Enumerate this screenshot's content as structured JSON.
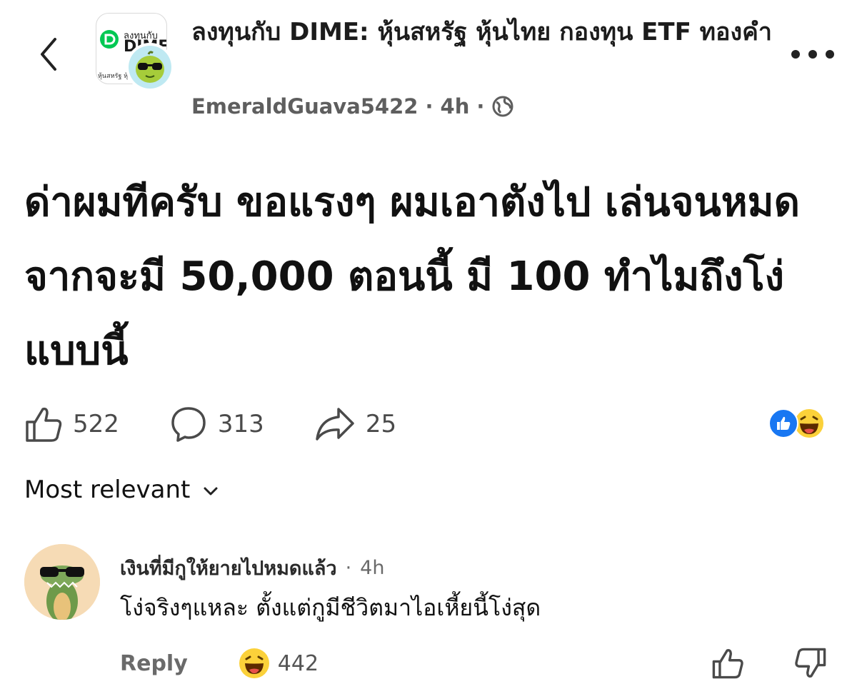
{
  "header": {
    "back_icon": "chevron-left-icon",
    "group_avatar": {
      "line1": "ลงทุนกับ",
      "line2": "DIME",
      "line3": "หุ้นสหรัฐ หุ้นไทย"
    },
    "group_name": "ลงทุนกับ DIME: หุ้นสหรัฐ หุ้นไทย กองทุน ETF ทองคำ",
    "author": "EmeraldGuava5422",
    "separator": "·",
    "time": "4h",
    "visibility_icon": "globe-icon",
    "more_icon": "ellipsis-icon"
  },
  "post": {
    "text": "ด่าผมทีครับ ขอแรงๆ ผมเอาตังไป เล่นจนหมด จากจะมี 50,000 ตอนนี้ มี 100 ทำไมถึงโง่แบบนี้"
  },
  "actions": {
    "likes": "522",
    "comments": "313",
    "shares": "25",
    "reaction_icons": [
      "like-icon",
      "haha-icon"
    ]
  },
  "sort": {
    "label": "Most relevant"
  },
  "comment": {
    "author": "เงินที่มีกูให้ยายไปหมดแล้ว",
    "separator": "·",
    "time": "4h",
    "text": "โง่จริงๆแหละ ตั้งแต่กูมีชีวิตมาไอเหี้ยนี้โง่สุด",
    "reply_label": "Reply",
    "reaction_count": "442"
  },
  "colors": {
    "accent": "#1877f2",
    "brand_green": "#00c853",
    "text": "#111111",
    "muted": "#5e5e5e"
  }
}
